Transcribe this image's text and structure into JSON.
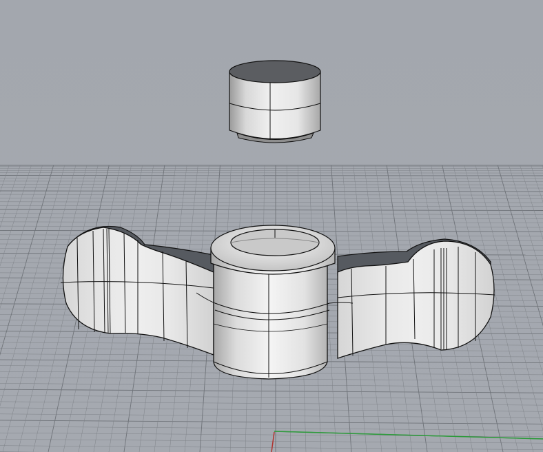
{
  "viewport": {
    "view_name": "",
    "background_color": "#a5a9b0",
    "grid_color": "#7f8389",
    "grid_major_color": "#6f7379",
    "x_axis_color": "#b0332e",
    "y_axis_color": "#2e9a3c",
    "object_surface_color": "#e2e2e2",
    "object_edge_color": "#111111"
  },
  "objects": [
    {
      "name": "cylinder-insert",
      "kind": "cylinder"
    },
    {
      "name": "wing-nut",
      "kind": "wing nut solid"
    }
  ]
}
